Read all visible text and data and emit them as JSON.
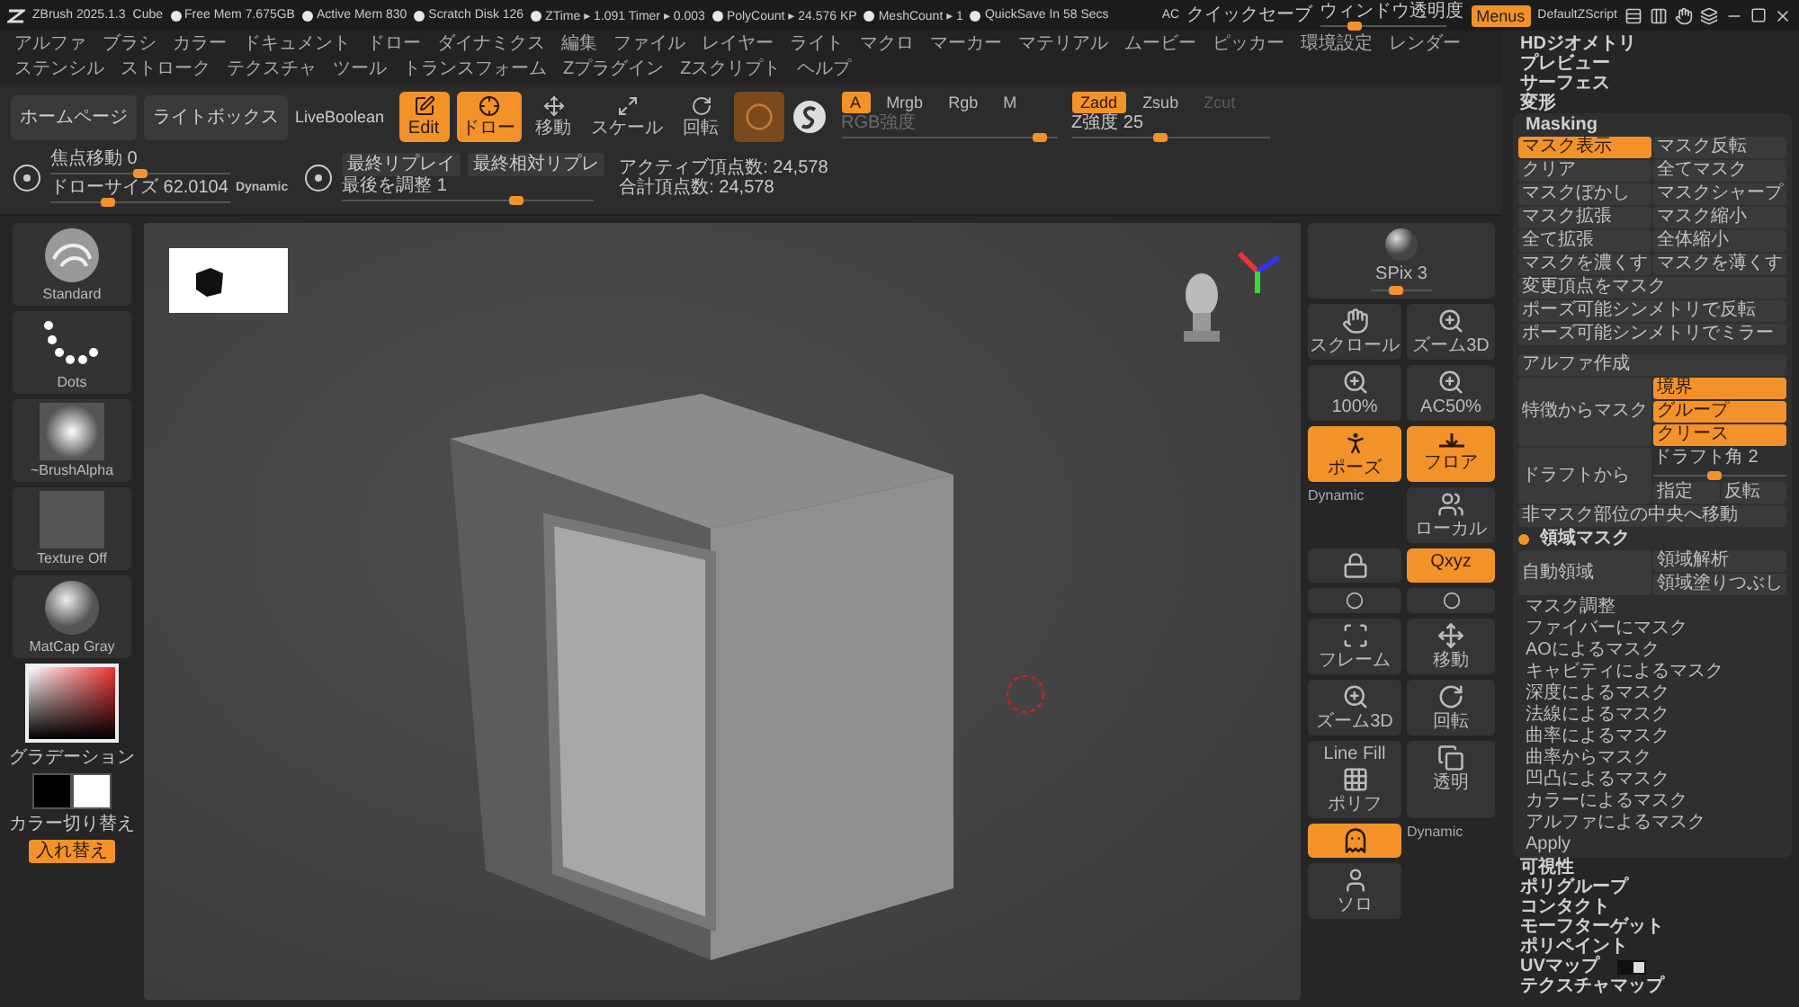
{
  "title_bar": {
    "app": "ZBrush 2025.1.3",
    "document": "Cube",
    "stats": [
      "Free Mem 7.675GB",
      "Active Mem 830",
      "Scratch Disk 126",
      "ZTime ▸ 1.091 Timer ▸ 0.003",
      "PolyCount ▸ 24.576 KP",
      "MeshCount ▸ 1",
      "QuickSave In 58 Secs"
    ],
    "ac": "AC",
    "quick_save": "クイックセーブ",
    "transparency": {
      "label": "ウィンドウ透明度",
      "level": 0.25
    },
    "menus_button": {
      "label": "Menus",
      "on": true
    },
    "script": "DefaultZScript"
  },
  "menu_bar": [
    "アルファ",
    "ブラシ",
    "カラー",
    "ドキュメント",
    "ドロー",
    "ダイナミクス",
    "編集",
    "ファイル",
    "レイヤー",
    "ライト",
    "マクロ",
    "マーカー",
    "マテリアル",
    "ムービー",
    "ピッカー",
    "環境設定",
    "レンダー",
    "ステンシル",
    "ストローク",
    "テクスチャ",
    "ツール",
    "トランスフォーム",
    "Zプラグイン",
    "Zスクリプト",
    "ヘルプ"
  ],
  "toolbar": {
    "nav_buttons": [
      "ホームページ",
      "ライトボックス"
    ],
    "live_boolean": "LiveBoolean",
    "modes": [
      {
        "label": "Edit",
        "kind": "edit",
        "on": true
      },
      {
        "label": "ドロー",
        "kind": "draw",
        "on": true
      },
      {
        "label": "移動",
        "kind": "move",
        "on": false
      },
      {
        "label": "スケール",
        "kind": "scale",
        "on": false
      },
      {
        "label": "回転",
        "kind": "rotate",
        "on": false
      }
    ],
    "color_channels": [
      {
        "label": "A",
        "on": true
      },
      {
        "label": "Mrgb",
        "on": false
      },
      {
        "label": "Rgb",
        "on": false
      },
      {
        "label": "M",
        "on": false
      }
    ],
    "rgb_intensity": {
      "label": "RGB強度",
      "level": 0.95
    },
    "z_modes": [
      {
        "label": "Zadd",
        "on": true,
        "disabled": false
      },
      {
        "label": "Zsub",
        "on": false,
        "disabled": false
      },
      {
        "label": "Zcut",
        "on": false,
        "disabled": true
      }
    ],
    "z_intensity": {
      "label": "Z強度 25",
      "level": 0.45
    },
    "focal_shift": {
      "label": "焦点移動 0",
      "level": 0.5
    },
    "draw_size": {
      "label": "ドローサイズ 62.0104",
      "level": 0.3
    },
    "dynamic": "Dynamic",
    "replay_buttons": [
      "最終リプレイ",
      "最終相対リプレ"
    ],
    "adjust_last": {
      "label": "最後を調整 1",
      "level": 0.7
    },
    "vertex_counts": [
      "アクティブ頂点数: 24,578",
      "合計頂点数: 24,578"
    ]
  },
  "left_shelf": {
    "swatches": [
      {
        "label": "Standard",
        "kind": "brush"
      },
      {
        "label": "Dots",
        "kind": "stroke"
      },
      {
        "label": "~BrushAlpha",
        "kind": "alpha"
      },
      {
        "label": "Texture Off",
        "kind": "texture"
      },
      {
        "label": "MatCap Gray",
        "kind": "material"
      }
    ],
    "gradient_label": "グラデーション",
    "colors": [
      {
        "color": "#000000"
      },
      {
        "color": "#ffffff"
      }
    ],
    "switch_label": "カラー切り替え",
    "swap_button": "入れ替え"
  },
  "right_shelf": [
    {
      "kind": "sphere",
      "label": "SPix 3",
      "level": 0.4,
      "on": false
    },
    {
      "kind": "hand",
      "label": "スクロール",
      "on": false
    },
    {
      "kind": "zoom",
      "label": "ズーム3D",
      "on": false
    },
    {
      "kind": "zoom",
      "label": "100%",
      "on": false
    },
    {
      "kind": "zoom",
      "label": "AC50%",
      "on": false
    },
    {
      "kind": "pose",
      "label": "ポーズ",
      "on": true
    },
    {
      "kind": "floor",
      "label": "フロア",
      "on": true
    },
    {
      "kind": "text",
      "label": "Dynamic",
      "on": false
    },
    {
      "kind": "people",
      "label": "ローカル",
      "on": false
    },
    {
      "kind": "lock",
      "on": false
    },
    {
      "kind": "text",
      "label": "Qxyz",
      "on": true
    },
    {
      "kind": "small",
      "on": false
    },
    {
      "kind": "small",
      "on": false
    },
    {
      "kind": "frame",
      "label": "フレーム",
      "on": false
    },
    {
      "kind": "move",
      "label": "移動",
      "on": false
    },
    {
      "kind": "zoom",
      "label": "ズーム3D",
      "on": false
    },
    {
      "kind": "rotate",
      "label": "回転",
      "on": false
    },
    {
      "kind": "grid",
      "label": "ポリフ",
      "caption": "Line Fill",
      "on": false
    },
    {
      "kind": "transparent",
      "label": "透明",
      "on": false
    },
    {
      "kind": "ghost",
      "on": true
    },
    {
      "kind": "text",
      "label": "Dynamic",
      "on": false
    },
    {
      "kind": "solo",
      "label": "ソロ",
      "on": false
    }
  ],
  "right_panel": {
    "top_items": [
      "HDジオメトリ",
      "プレビュー",
      "サーフェス",
      "変形"
    ],
    "masking": {
      "title": "Masking",
      "grid_buttons": [
        {
          "label": "マスク表示",
          "on": true
        },
        {
          "label": "マスク反転",
          "on": false
        },
        {
          "label": "クリア",
          "on": false
        },
        {
          "label": "全てマスク",
          "on": false
        },
        {
          "label": "マスクぼかし",
          "on": false
        },
        {
          "label": "マスクシャープ",
          "on": false
        },
        {
          "label": "マスク拡張",
          "on": false
        },
        {
          "label": "マスク縮小",
          "on": false
        },
        {
          "label": "全て拡張",
          "on": false
        },
        {
          "label": "全体縮小",
          "on": false
        },
        {
          "label": "マスクを濃くす",
          "on": false
        },
        {
          "label": "マスクを薄くす",
          "on": false
        }
      ],
      "wide_buttons": [
        "変更頂点をマスク",
        "ポーズ可能シンメトリで反転",
        "ポーズ可能シンメトリでミラー"
      ],
      "alpha_button": "アルファ作成",
      "feature_mask": {
        "label": "特徴からマスク",
        "options": [
          {
            "label": "境界",
            "on": true
          },
          {
            "label": "グループ",
            "on": true
          },
          {
            "label": "クリース",
            "on": true
          }
        ]
      },
      "draft": {
        "label": "ドラフトから",
        "slider": {
          "label": "ドラフト角 2",
          "level": 0.45
        },
        "buttons": [
          "指定",
          "反転"
        ]
      },
      "center_button": "非マスク部位の中央へ移動",
      "region_mask": {
        "title": "領域マスク",
        "on": true,
        "auto": "自動領域",
        "buttons": [
          "領域解析",
          "領域塗りつぶし"
        ]
      },
      "adjust_items": [
        "マスク調整",
        "ファイバーにマスク",
        "AOによるマスク",
        "キャビティによるマスク",
        "深度によるマスク",
        "法線によるマスク",
        "曲率によるマスク",
        "曲率からマスク",
        "凹凸によるマスク",
        "カラーによるマスク",
        "アルファによるマスク",
        "Apply"
      ]
    },
    "bottom_items": [
      {
        "label": "可視性",
        "toggle": false
      },
      {
        "label": "ポリグループ",
        "toggle": false
      },
      {
        "label": "コンタクト",
        "toggle": false
      },
      {
        "label": "モーフターゲット",
        "toggle": false
      },
      {
        "label": "ポリペイント",
        "toggle": false
      },
      {
        "label": "UVマップ",
        "toggle": true
      },
      {
        "label": "テクスチャマップ",
        "toggle": false
      }
    ]
  }
}
